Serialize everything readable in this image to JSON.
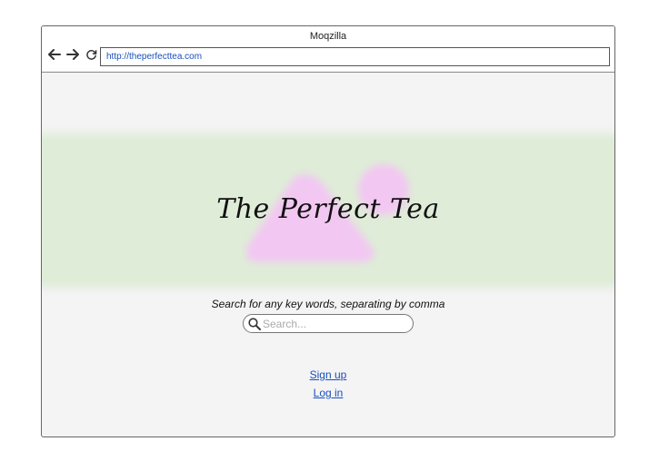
{
  "window": {
    "title": "Moqzilla"
  },
  "toolbar": {
    "back_icon": "arrow-left",
    "forward_icon": "arrow-right",
    "reload_icon": "reload",
    "url": "http://theperfecttea.com"
  },
  "banner": {
    "brand": "The Perfect Tea",
    "logo": "tea-drop-shape",
    "colors": {
      "background": "#dfecd8",
      "logo": "#f2c8f2"
    }
  },
  "search": {
    "label": "Search for any key words, separating by comma",
    "placeholder": "Search..."
  },
  "links": {
    "signup": "Sign up",
    "login": "Log in"
  },
  "colors": {
    "link": "#1a4fbd",
    "page_bg": "#f4f4f4"
  }
}
